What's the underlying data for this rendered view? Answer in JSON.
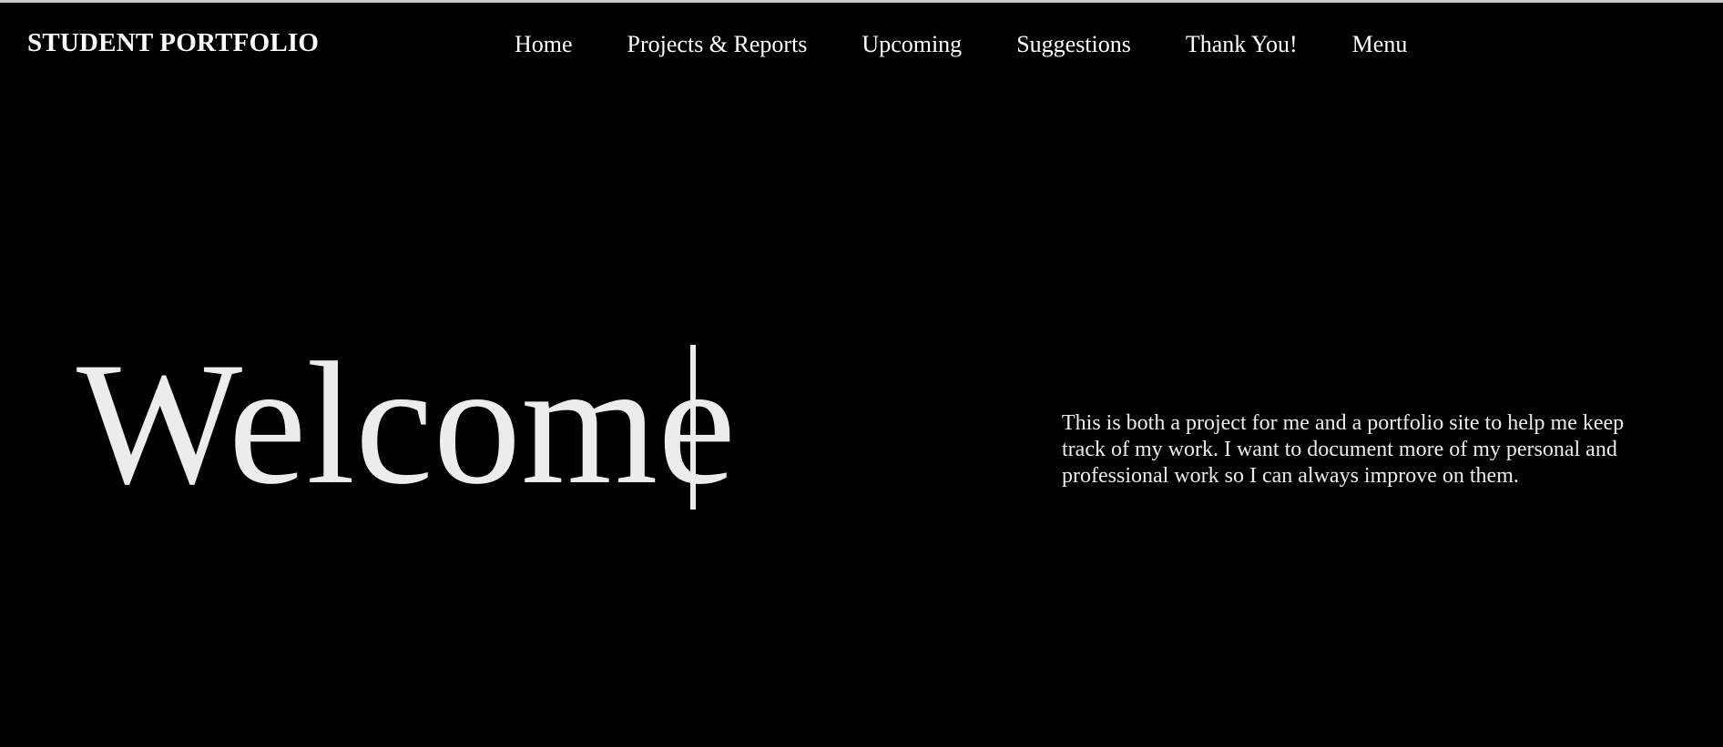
{
  "header": {
    "brand": "STUDENT PORTFOLIO",
    "nav": [
      {
        "label": "Home"
      },
      {
        "label": "Projects & Reports"
      },
      {
        "label": "Upcoming"
      },
      {
        "label": "Suggestions"
      },
      {
        "label": "Thank You!"
      },
      {
        "label": "Menu"
      }
    ]
  },
  "hero": {
    "title": "Welcome",
    "intro": "This is both a project for me and a portfolio site to help me keep track of my work. I want to document more of my personal and professional work so I can always improve on them."
  },
  "colors": {
    "background": "#000000",
    "text": "#ffffff",
    "hero_text": "#ececec"
  }
}
